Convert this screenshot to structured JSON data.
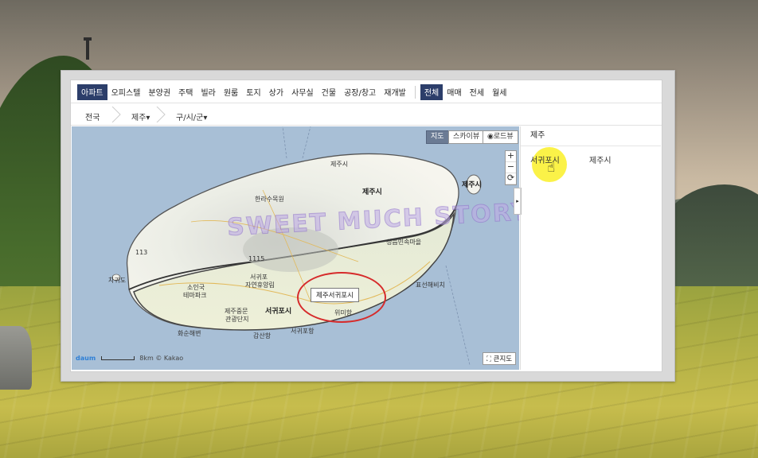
{
  "category_tabs": [
    "아파트",
    "오피스텔",
    "분양권",
    "주택",
    "빌라",
    "원룸",
    "토지",
    "상가",
    "사무실",
    "건물",
    "공장/창고",
    "재개발"
  ],
  "deal_tabs": [
    "전체",
    "매매",
    "전세",
    "월세"
  ],
  "breadcrumb": {
    "level1": "전국",
    "level2": "제주▾",
    "level3": "구/시/군▾"
  },
  "map": {
    "mode_map": "지도",
    "mode_sky": "스카이뷰",
    "mode_road": "◉로드뷰",
    "zoom_in": "+",
    "zoom_out": "−",
    "reset": "⟳",
    "labels": {
      "jeju_si": "제주시",
      "jeju_si_top": "제주시",
      "jeju_si_mid": "제주시",
      "hallasan": "한라수목원",
      "folk_village": "성읍민속마을",
      "seogwipo_area": "서귀포",
      "nature_forest": "자연휴양림",
      "soingook": "소인국",
      "theme_park": "테마파크",
      "jungmun": "제주중문",
      "resort": "관광단지",
      "seogwipo_si": "서귀포시",
      "seogwipo_port": "서귀포항",
      "wimi_port": "위미항",
      "gamsan": "감산항",
      "hwasun": "화순해변",
      "chagwido": "차귀도",
      "pyoseon": "표선해비치",
      "route_115": "1115",
      "route_113": "113"
    },
    "watermark": "SWEET MUCH STORY",
    "callout": "제주서귀포시",
    "scale_text": "8km",
    "logo": "daum",
    "copyright": "© Kakao",
    "big_map": "⛶ 큰지도",
    "collapse_arrow": "▸"
  },
  "side": {
    "title": "제주",
    "items": [
      "서귀포시",
      "제주시"
    ],
    "cursor": "☝"
  },
  "colors": {
    "active_tab": "#2c3e6a",
    "callout_ring": "#d62b2b",
    "highlight": "#faf028"
  }
}
